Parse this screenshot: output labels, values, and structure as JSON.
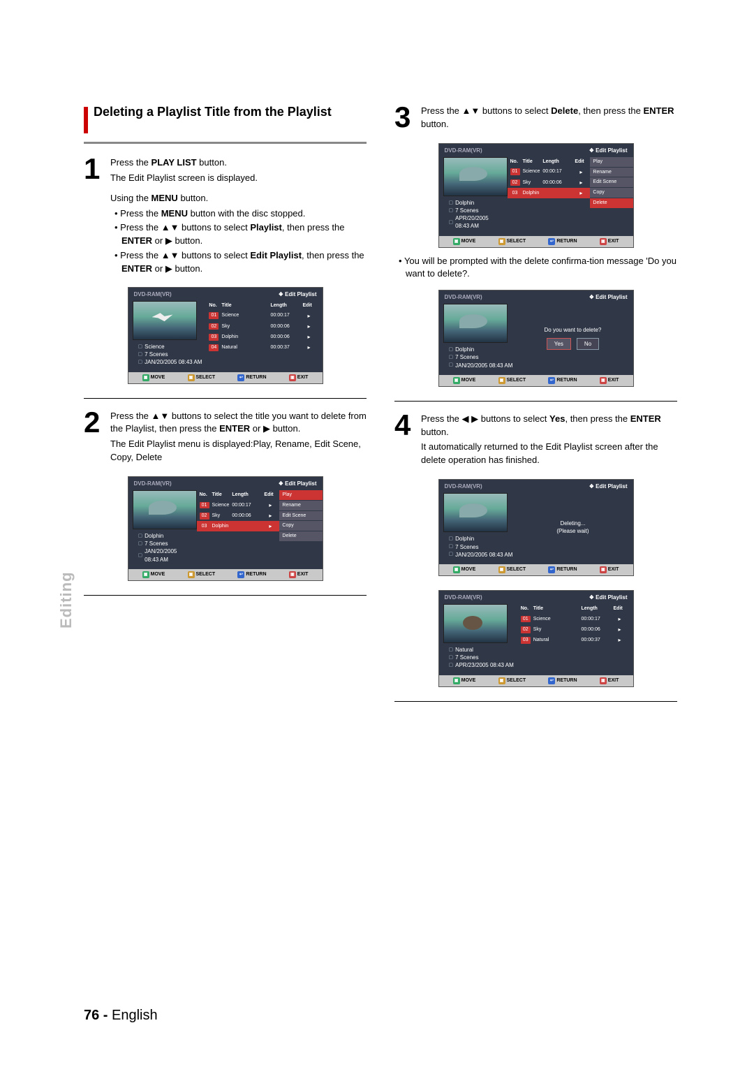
{
  "section": {
    "heading": "Deleting a Playlist Title from the Playlist"
  },
  "sidetab": "Editing",
  "footer": {
    "page": "76 -",
    "lang": "English"
  },
  "arrows": {
    "ud": "▲▼",
    "lr": "◀ ▶",
    "play": "▶"
  },
  "steps": {
    "s1": {
      "num": "1",
      "l1a": "Press the ",
      "l1b": "PLAY LIST",
      "l1c": " button.",
      "l2": "The Edit Playlist screen is displayed.",
      "using_a": "Using the ",
      "using_b": "MENU",
      "using_c": " button.",
      "b1a": "Press the ",
      "b1b": "MENU",
      "b1c": " button with the disc stopped.",
      "b2a": "Press the ",
      "b2b": " buttons to select ",
      "b2c": "Playlist",
      "b2d": ", then press the ",
      "b2e": "ENTER",
      "b2f": " or ",
      "b2g": " button.",
      "b3a": "Press the ",
      "b3b": " buttons to select ",
      "b3c": "Edit Playlist",
      "b3d": ", then press the ",
      "b3e": "ENTER",
      "b3f": " or ",
      "b3g": " button."
    },
    "s2": {
      "num": "2",
      "l1a": "Press the ",
      "l1b": " buttons to select the title you want to delete from the Playlist, then press the ",
      "l1c": "ENTER",
      "l1d": " or ",
      "l1e": " button.",
      "l2": "The Edit Playlist menu is displayed:Play, Rename, Edit Scene, Copy, Delete"
    },
    "s3": {
      "num": "3",
      "l1a": "Press the ",
      "l1b": " buttons to select ",
      "l1c": "Delete",
      "l1d": ", then press the ",
      "l1e": "ENTER",
      "l1f": " button.",
      "note": "You will be prompted with the delete confirma-tion  message 'Do you want to delete?."
    },
    "s4": {
      "num": "4",
      "l1a": "Press the ",
      "l1b": " buttons to select ",
      "l1c": "Yes",
      "l1d": ", then press the ",
      "l1e": "ENTER",
      "l1f": " button.",
      "l2": "It automatically returned to the Edit Playlist screen after the delete operation has finished."
    }
  },
  "osd_common": {
    "disc": "DVD-RAM(VR)",
    "crumb_prefix": "❖",
    "screen": "Edit Playlist",
    "hdr_no": "No.",
    "hdr_title": "Title",
    "hdr_length": "Length",
    "hdr_edit": "Edit",
    "foot_move": "MOVE",
    "foot_select": "SELECT",
    "foot_return": "RETURN",
    "foot_exit": "EXIT",
    "scenes": "7 Scenes"
  },
  "osd1": {
    "title_info": "Science",
    "date": "JAN/20/2005 08:43 AM",
    "rows": [
      {
        "n": "01",
        "t": "Science",
        "len": "00:00:17"
      },
      {
        "n": "02",
        "t": "Sky",
        "len": "00:00:06"
      },
      {
        "n": "03",
        "t": "Dolphin",
        "len": "00:00:06"
      },
      {
        "n": "04",
        "t": "Natural",
        "len": "00:00:37"
      }
    ]
  },
  "osd2": {
    "title_info": "Dolphin",
    "date": "JAN/20/2005 08:43 AM",
    "rows": [
      {
        "n": "01",
        "t": "Science",
        "len": "00:00:17"
      },
      {
        "n": "02",
        "t": "Sky",
        "len": "00:00:06"
      },
      {
        "n": "03",
        "t": "Dolphin",
        "len": ""
      }
    ],
    "menu": [
      "Play",
      "Rename",
      "Edit Scene",
      "Copy",
      "Delete"
    ],
    "hl": 0
  },
  "osd3": {
    "title_info": "Dolphin",
    "date": "APR/20/2005 08:43 AM",
    "rows": [
      {
        "n": "01",
        "t": "Science",
        "len": "00:00:17"
      },
      {
        "n": "02",
        "t": "Sky",
        "len": "00:00:06"
      },
      {
        "n": "03",
        "t": "Dolphin",
        "len": ""
      }
    ],
    "menu": [
      "Play",
      "Rename",
      "Edit Scene",
      "Copy",
      "Delete"
    ],
    "hl": 4
  },
  "osd4": {
    "title_info": "Dolphin",
    "date": "JAN/20/2005 08:43 AM",
    "question": "Do you want to delete?",
    "yes": "Yes",
    "no": "No"
  },
  "osd5": {
    "title_info": "Dolphin",
    "date": "JAN/20/2005 08:43 AM",
    "status1": "Deleting...",
    "status2": "(Please wait)"
  },
  "osd6": {
    "title_info": "Natural",
    "date": "APR/23/2005 08:43 AM",
    "rows": [
      {
        "n": "01",
        "t": "Science",
        "len": "00:00:17"
      },
      {
        "n": "02",
        "t": "Sky",
        "len": "00:00:06"
      },
      {
        "n": "03",
        "t": "Natural",
        "len": "00:00:37"
      }
    ]
  }
}
